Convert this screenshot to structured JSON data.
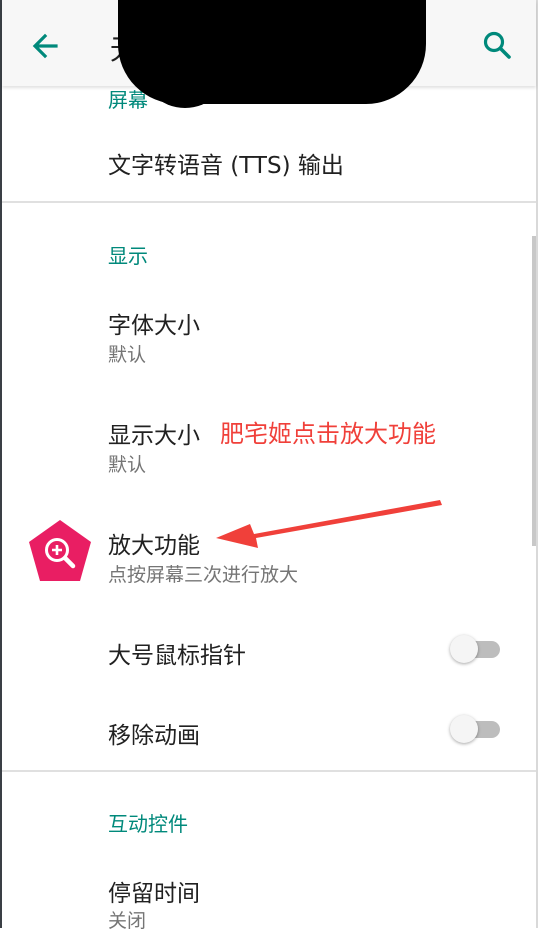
{
  "toolbar": {
    "title_partial": "无",
    "back_icon": "arrow-back-icon",
    "search_icon": "search-icon",
    "accent": "#00897b"
  },
  "sections": {
    "screen_reader_header_partial": "屏幕",
    "display_header": "显示",
    "interaction_header": "互动控件"
  },
  "items": {
    "tts": {
      "title": "文字转语音 (TTS) 输出"
    },
    "font_size": {
      "title": "字体大小",
      "summary": "默认"
    },
    "display_size": {
      "title": "显示大小",
      "summary": "默认"
    },
    "magnification": {
      "title": "放大功能",
      "summary": "点按屏幕三次进行放大",
      "icon": "magnify-plus-icon",
      "icon_color": "#e91e63"
    },
    "large_pointer": {
      "title": "大号鼠标指针",
      "toggle": "off"
    },
    "remove_animations": {
      "title": "移除动画",
      "toggle": "off"
    },
    "dwell_timing": {
      "title": "停留时间",
      "summary": "关闭"
    }
  },
  "annotation": {
    "text": "肥宅姬点击放大功能",
    "color": "#f0403a"
  }
}
